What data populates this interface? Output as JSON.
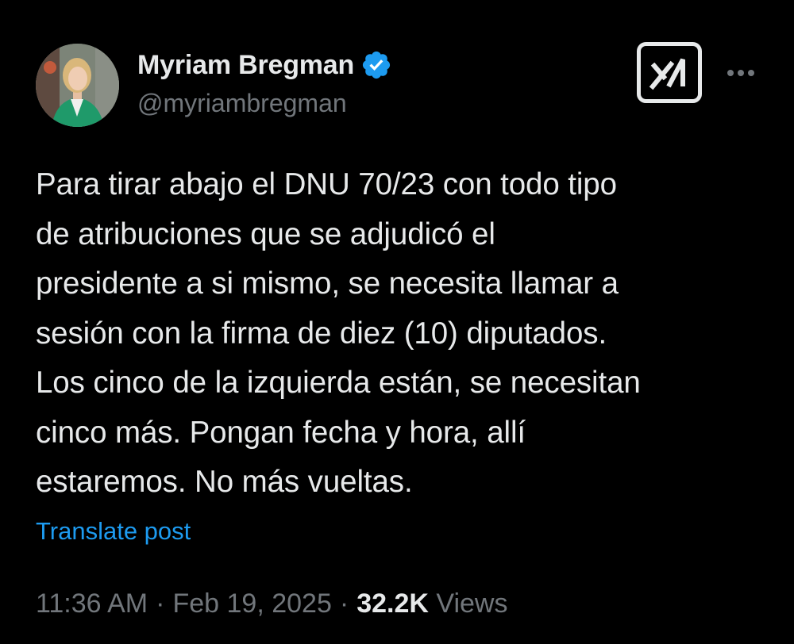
{
  "author": {
    "display_name": "Myriam Bregman",
    "handle": "@myriambregman",
    "verified": true,
    "avatar_icon": "profile-photo"
  },
  "actions": {
    "grok_icon": "grok-icon",
    "more_icon": "more-options-icon"
  },
  "tweet": {
    "lines": [
      "Para tirar abajo el DNU 70/23 con todo tipo",
      "de atribuciones que se adjudicó el",
      "presidente a si mismo, se necesita llamar a",
      "sesión con la firma de diez (10) diputados.",
      "Los cinco de la izquierda están, se necesitan",
      "cinco más. Pongan fecha y hora, allí",
      "estaremos. No más vueltas."
    ],
    "translate_label": "Translate post"
  },
  "meta": {
    "time": "11:36 AM",
    "date": "Feb 19, 2025",
    "separator": "·",
    "views_count": "32.2K",
    "views_label": "Views"
  },
  "colors": {
    "background": "#000000",
    "text_primary": "#e7e9ea",
    "text_secondary": "#71767b",
    "link": "#1d9bf0",
    "verified": "#1d9bf0"
  }
}
